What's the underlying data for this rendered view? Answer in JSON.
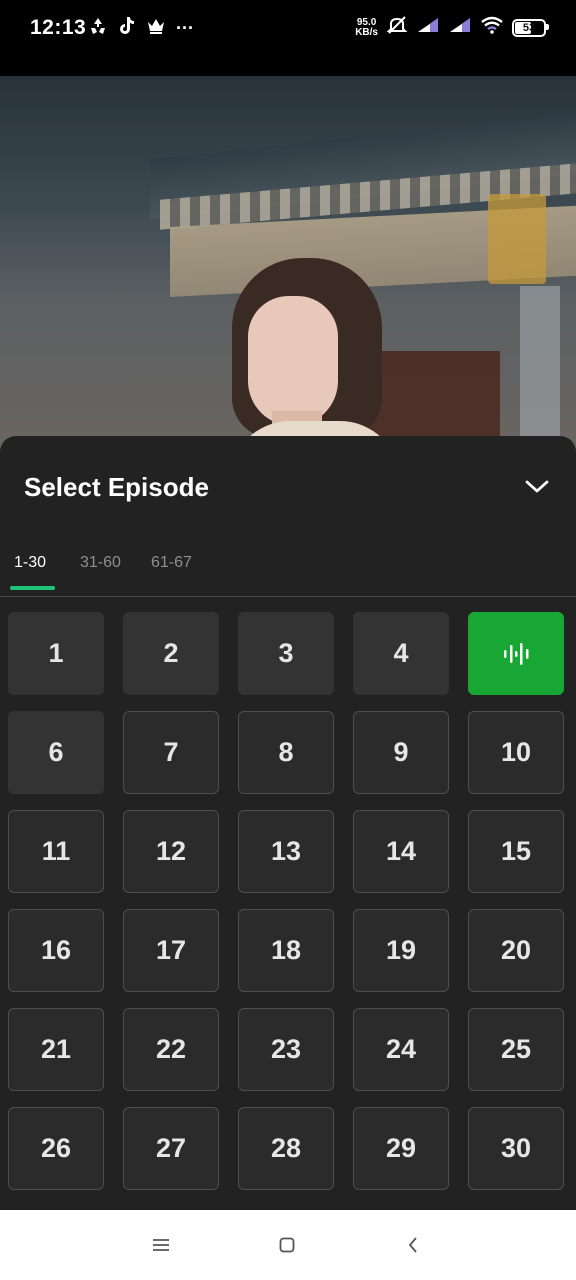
{
  "status_bar": {
    "time": "12:13",
    "net_speed_value": "95.0",
    "net_speed_unit": "KB/s",
    "battery_level": "53",
    "more_glyph": "···"
  },
  "sheet": {
    "title": "Select Episode",
    "tabs": [
      {
        "label": "1-30",
        "active": true
      },
      {
        "label": "31-60",
        "active": false
      },
      {
        "label": "61-67",
        "active": false
      }
    ],
    "episodes": [
      {
        "label": "1",
        "state": "watched"
      },
      {
        "label": "2",
        "state": "watched"
      },
      {
        "label": "3",
        "state": "watched"
      },
      {
        "label": "4",
        "state": "watched"
      },
      {
        "label": "",
        "state": "playing"
      },
      {
        "label": "6",
        "state": "watched"
      },
      {
        "label": "7",
        "state": "normal"
      },
      {
        "label": "8",
        "state": "normal"
      },
      {
        "label": "9",
        "state": "normal"
      },
      {
        "label": "10",
        "state": "normal"
      },
      {
        "label": "11",
        "state": "normal"
      },
      {
        "label": "12",
        "state": "normal"
      },
      {
        "label": "13",
        "state": "normal"
      },
      {
        "label": "14",
        "state": "normal"
      },
      {
        "label": "15",
        "state": "normal"
      },
      {
        "label": "16",
        "state": "normal"
      },
      {
        "label": "17",
        "state": "normal"
      },
      {
        "label": "18",
        "state": "normal"
      },
      {
        "label": "19",
        "state": "normal"
      },
      {
        "label": "20",
        "state": "normal"
      },
      {
        "label": "21",
        "state": "normal"
      },
      {
        "label": "22",
        "state": "normal"
      },
      {
        "label": "23",
        "state": "normal"
      },
      {
        "label": "24",
        "state": "normal"
      },
      {
        "label": "25",
        "state": "normal"
      },
      {
        "label": "26",
        "state": "normal"
      },
      {
        "label": "27",
        "state": "normal"
      },
      {
        "label": "28",
        "state": "normal"
      },
      {
        "label": "29",
        "state": "normal"
      },
      {
        "label": "30",
        "state": "normal"
      }
    ]
  },
  "colors": {
    "accent_green": "#18a734",
    "tab_indicator": "#1ec37a",
    "sheet_bg": "#222222"
  },
  "icons": {
    "collapse": "chevron-down-icon",
    "playing": "sound-wave-icon",
    "nav_menu": "menu-icon",
    "nav_home": "home-square-icon",
    "nav_back": "back-chevron-icon"
  }
}
